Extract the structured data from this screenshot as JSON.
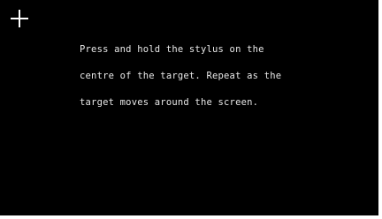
{
  "calibration": {
    "target_icon": "crosshair-icon",
    "instruction_lines": [
      "Press and hold the stylus on the",
      "centre of the target. Repeat as the",
      "target moves around the screen."
    ]
  },
  "colors": {
    "background": "#000000",
    "text": "#e8e8e8",
    "target": "#ffffff"
  }
}
